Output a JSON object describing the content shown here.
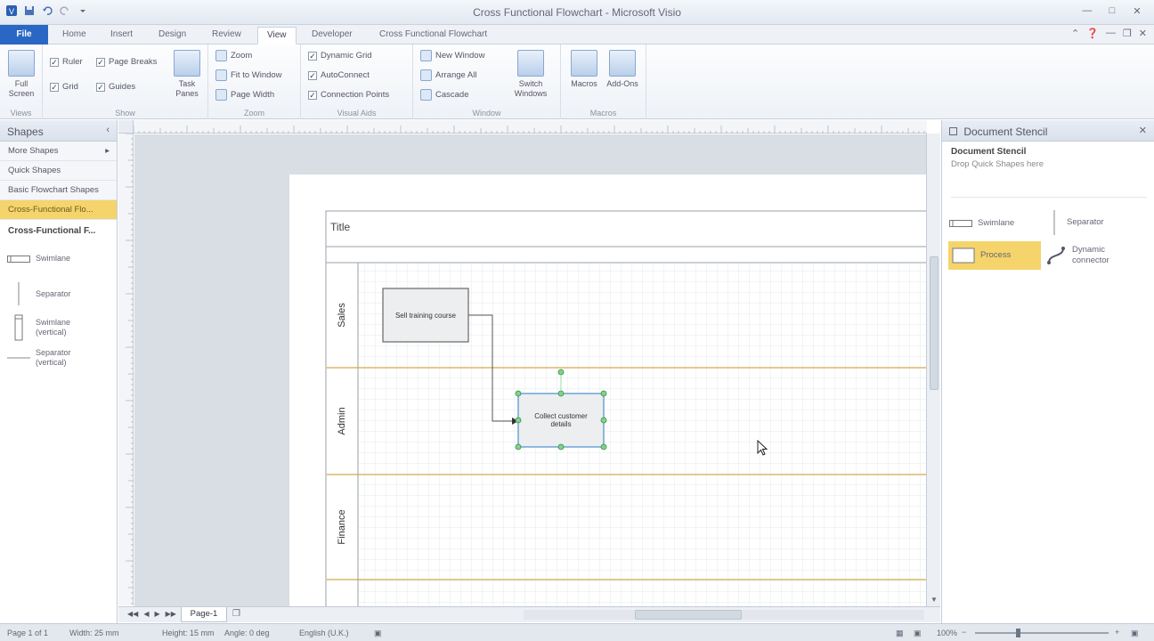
{
  "window": {
    "title": "Cross Functional Flowchart - Microsoft Visio"
  },
  "ribbon_tabs": [
    "File",
    "Home",
    "Insert",
    "Design",
    "Review",
    "View",
    "Developer",
    "Cross Functional Flowchart"
  ],
  "active_tab": "View",
  "ribbon": {
    "views": {
      "full_screen": "Full Screen",
      "label": "Views"
    },
    "show": {
      "ruler": "Ruler",
      "page_breaks": "Page Breaks",
      "grid": "Grid",
      "guides": "Guides",
      "task_panes": "Task Panes",
      "label": "Show"
    },
    "zoom": {
      "zoom": "Zoom",
      "fit_to_window": "Fit to Window",
      "page_width": "Page Width",
      "label": "Zoom"
    },
    "visual_aids": {
      "dynamic_grid": "Dynamic Grid",
      "autoconnect": "AutoConnect",
      "connection_points": "Connection Points",
      "label": "Visual Aids"
    },
    "window": {
      "new_window": "New Window",
      "arrange_all": "Arrange All",
      "cascade": "Cascade",
      "switch_windows": "Switch Windows",
      "label": "Window"
    },
    "macros": {
      "macros": "Macros",
      "add_ons": "Add-Ons",
      "label": "Macros"
    }
  },
  "shapes_pane": {
    "title": "Shapes",
    "items": [
      "More Shapes",
      "Quick Shapes",
      "Basic Flowchart Shapes",
      "Cross-Functional Flo..."
    ],
    "selected_index": 3,
    "stencil_name": "Cross-Functional F...",
    "shapes": [
      "Swimlane",
      "Separator",
      "Swimlane (vertical)",
      "Separator (vertical)"
    ]
  },
  "diagram": {
    "title": "Title",
    "lanes": [
      "Sales",
      "Admin",
      "Finance"
    ],
    "process1": "Sell training course",
    "process2": "Collect customer details"
  },
  "page_tabs": {
    "page1": "Page-1"
  },
  "doc_stencil": {
    "title": "Document Stencil",
    "stencil_title": "Document Stencil",
    "hint": "Drop Quick Shapes here",
    "masters": [
      "Swimlane",
      "Separator",
      "Process",
      "Dynamic connector"
    ]
  },
  "status": {
    "page": "Page 1 of 1",
    "width": "Width: 25 mm",
    "height": "Height: 15 mm",
    "angle": "Angle: 0 deg",
    "language": "English (U.K.)",
    "zoom": "100%"
  }
}
